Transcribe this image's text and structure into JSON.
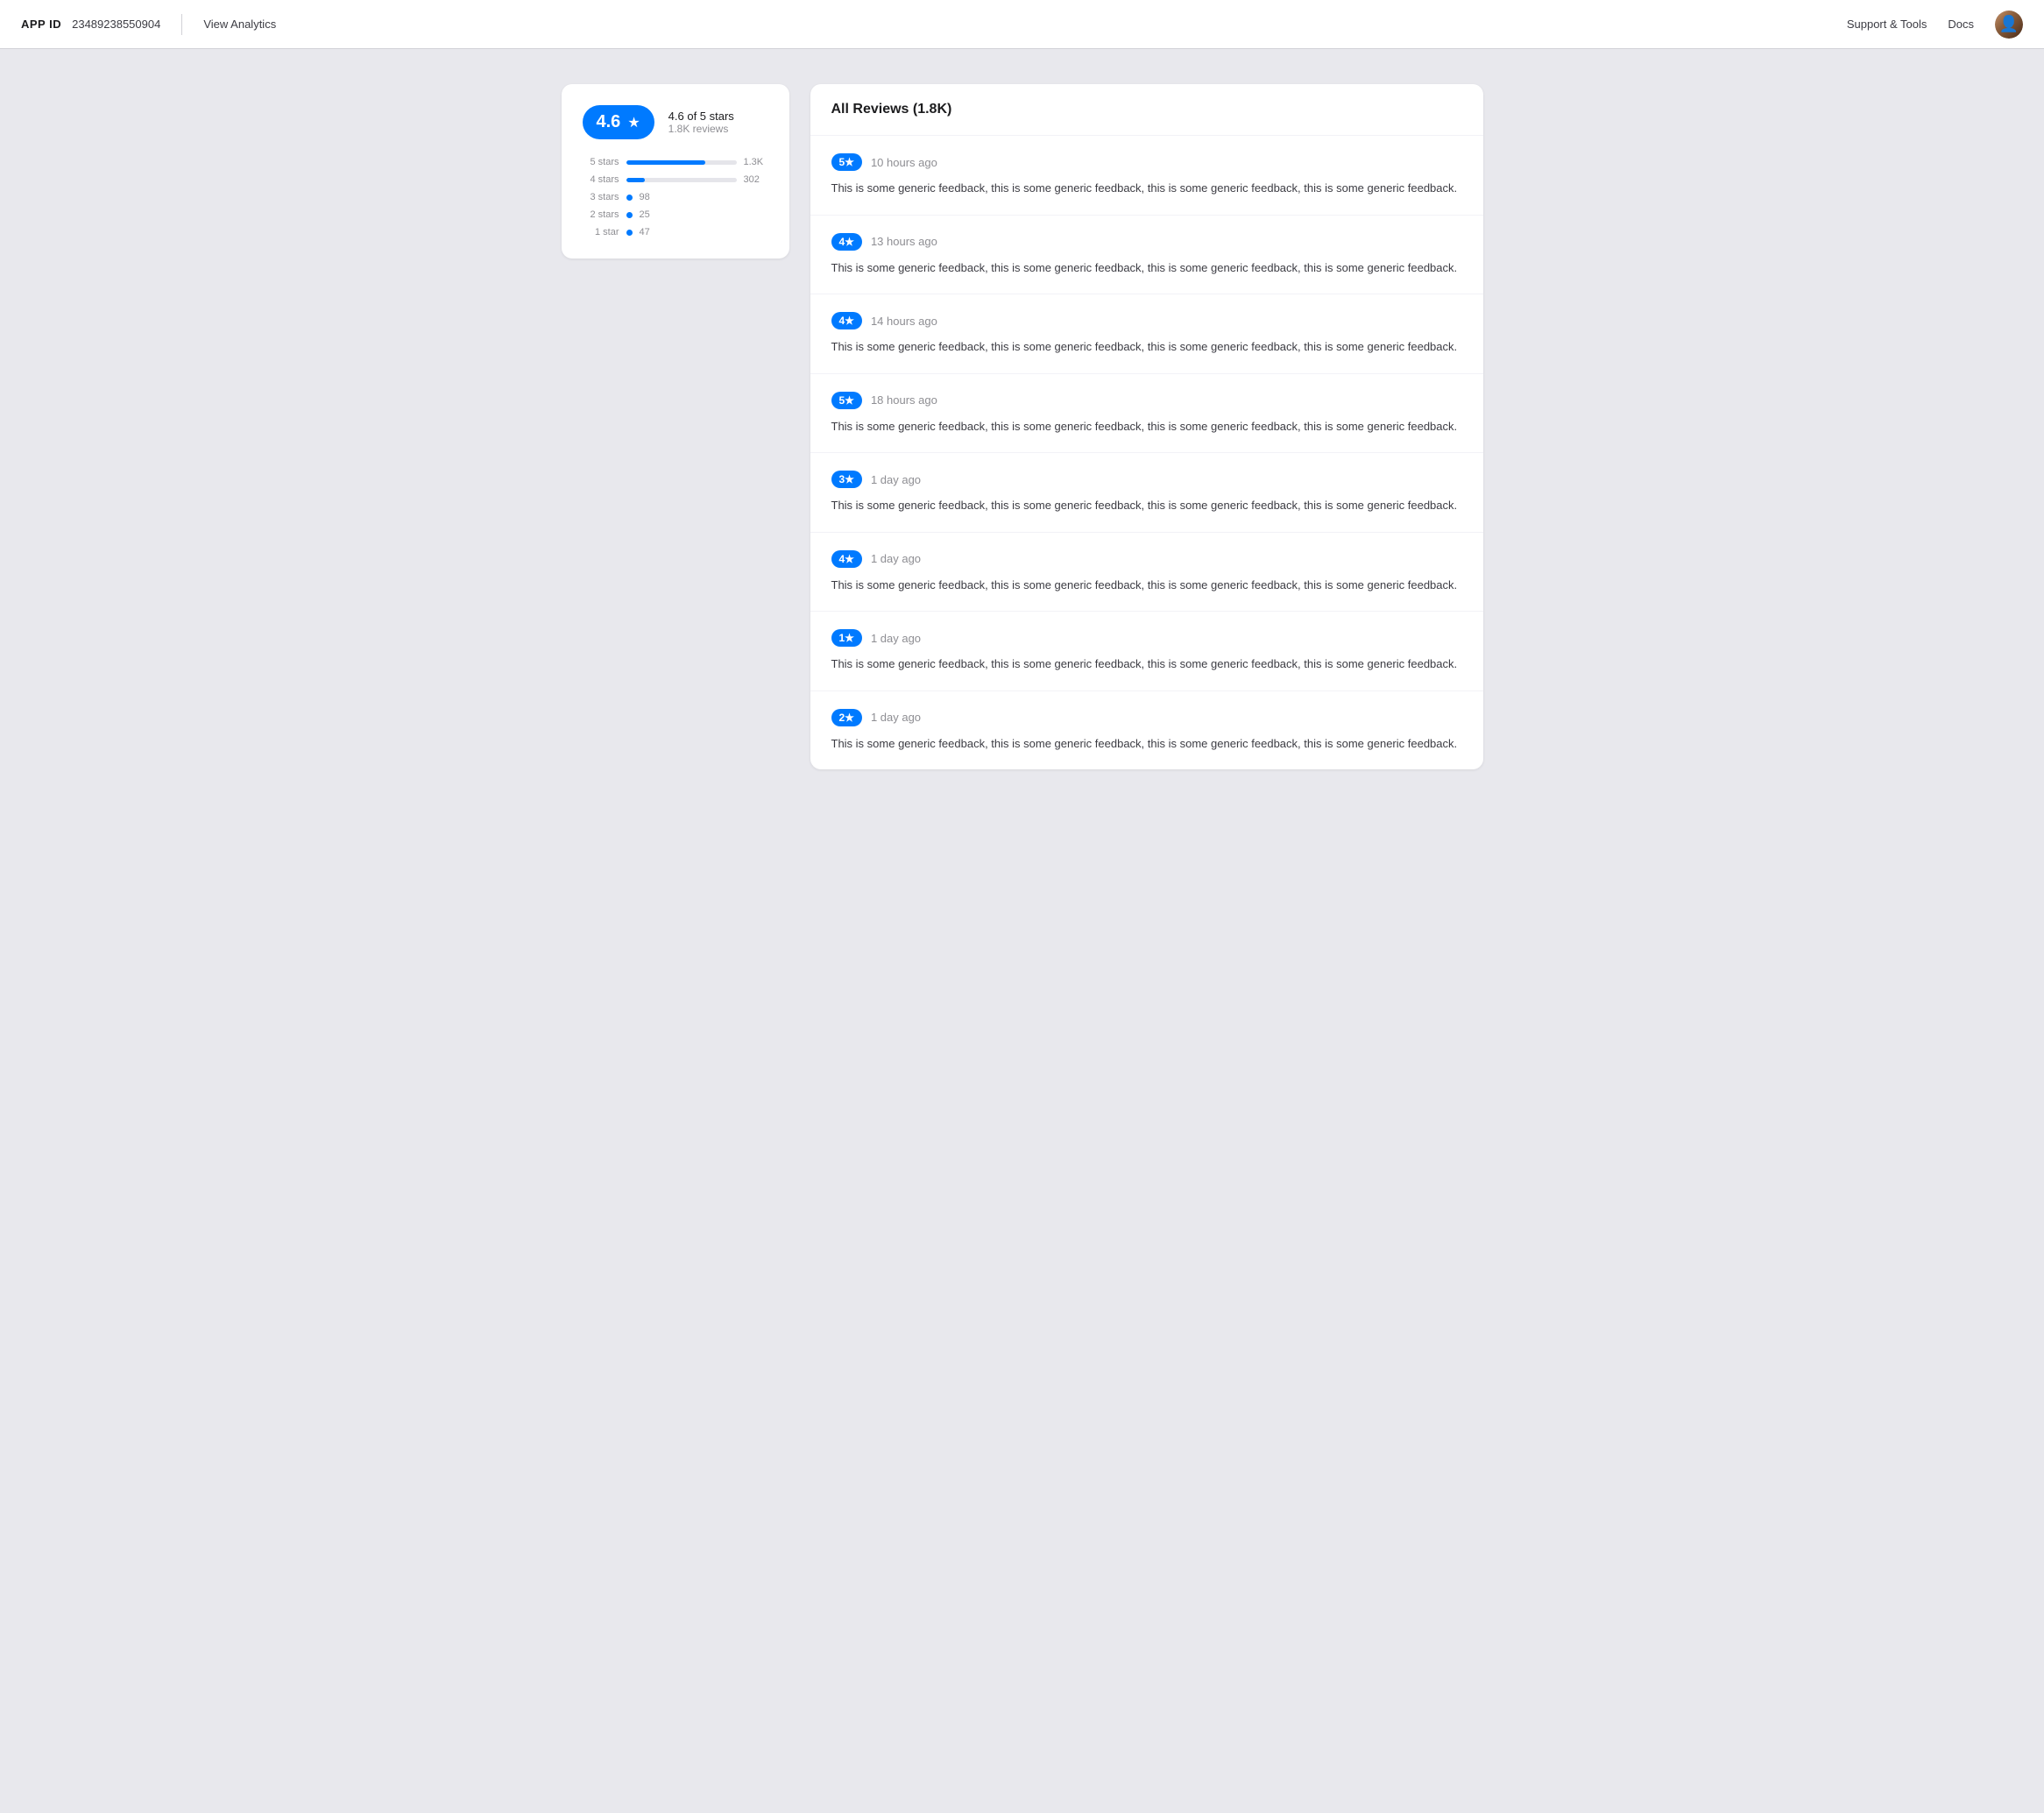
{
  "header": {
    "app_id_label": "APP ID",
    "app_id_value": "23489238550904",
    "view_analytics_label": "View Analytics",
    "support_tools_label": "Support & Tools",
    "docs_label": "Docs"
  },
  "rating_card": {
    "rating_value": "4.6",
    "star_symbol": "★",
    "rating_out_of": "4.6 of 5 stars",
    "review_count": "1.8K reviews",
    "bars": [
      {
        "label": "5 stars",
        "count": "1.3K",
        "pct": 72,
        "dot": false
      },
      {
        "label": "4 stars",
        "count": "302",
        "pct": 17,
        "dot": false
      },
      {
        "label": "3 stars",
        "count": "98",
        "pct": 5,
        "dot": true
      },
      {
        "label": "2 stars",
        "count": "25",
        "pct": 1,
        "dot": true
      },
      {
        "label": "1 star",
        "count": "47",
        "pct": 3,
        "dot": true
      }
    ]
  },
  "reviews": {
    "title": "All Reviews (1.8K)",
    "items": [
      {
        "stars": "5★",
        "time": "10 hours ago",
        "text": "This is some generic feedback, this is some generic feedback, this is some generic feedback, this is some generic feedback."
      },
      {
        "stars": "4★",
        "time": "13 hours ago",
        "text": "This is some generic feedback, this is some generic feedback, this is some generic feedback, this is some generic feedback."
      },
      {
        "stars": "4★",
        "time": "14 hours ago",
        "text": "This is some generic feedback, this is some generic feedback, this is some generic feedback, this is some generic feedback."
      },
      {
        "stars": "5★",
        "time": "18 hours ago",
        "text": "This is some generic feedback, this is some generic feedback, this is some generic feedback, this is some generic feedback."
      },
      {
        "stars": "3★",
        "time": "1 day ago",
        "text": "This is some generic feedback, this is some generic feedback, this is some generic feedback, this is some generic feedback."
      },
      {
        "stars": "4★",
        "time": "1 day ago",
        "text": "This is some generic feedback, this is some generic feedback, this is some generic feedback, this is some generic feedback."
      },
      {
        "stars": "1★",
        "time": "1 day ago",
        "text": "This is some generic feedback, this is some generic feedback, this is some generic feedback, this is some generic feedback."
      },
      {
        "stars": "2★",
        "time": "1 day ago",
        "text": "This is some generic feedback, this is some generic feedback, this is some generic feedback, this is some generic feedback."
      }
    ]
  }
}
